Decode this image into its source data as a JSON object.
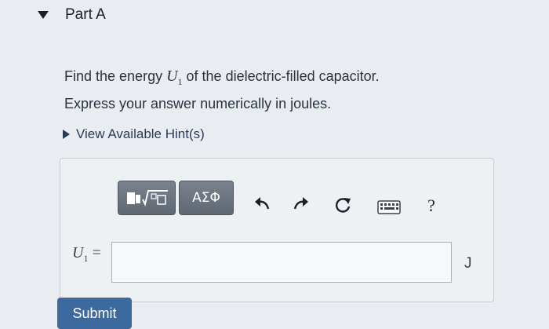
{
  "part": {
    "title": "Part A"
  },
  "question": {
    "prefix": "Find the energy ",
    "var_symbol": "U",
    "var_subscript": "1",
    "suffix": " of the dielectric-filled capacitor.",
    "instruction": "Express your answer numerically in joules."
  },
  "hints": {
    "label": "View Available Hint(s)"
  },
  "toolbar": {
    "templates_icon": "templates-sqrt-icon",
    "greek_label": "ΑΣΦ",
    "undo_icon": "undo-icon",
    "redo_icon": "redo-icon",
    "reset_icon": "reset-icon",
    "keyboard_icon": "keyboard-icon",
    "help_label": "?"
  },
  "answer": {
    "var_symbol": "U",
    "var_subscript": "1",
    "equals": " =",
    "value": "",
    "unit": "J"
  },
  "submit": {
    "label": "Submit"
  },
  "colors": {
    "background": "#e9edf1",
    "toolbar_button": "#6b7380",
    "submit_button": "#3c6a9e"
  }
}
